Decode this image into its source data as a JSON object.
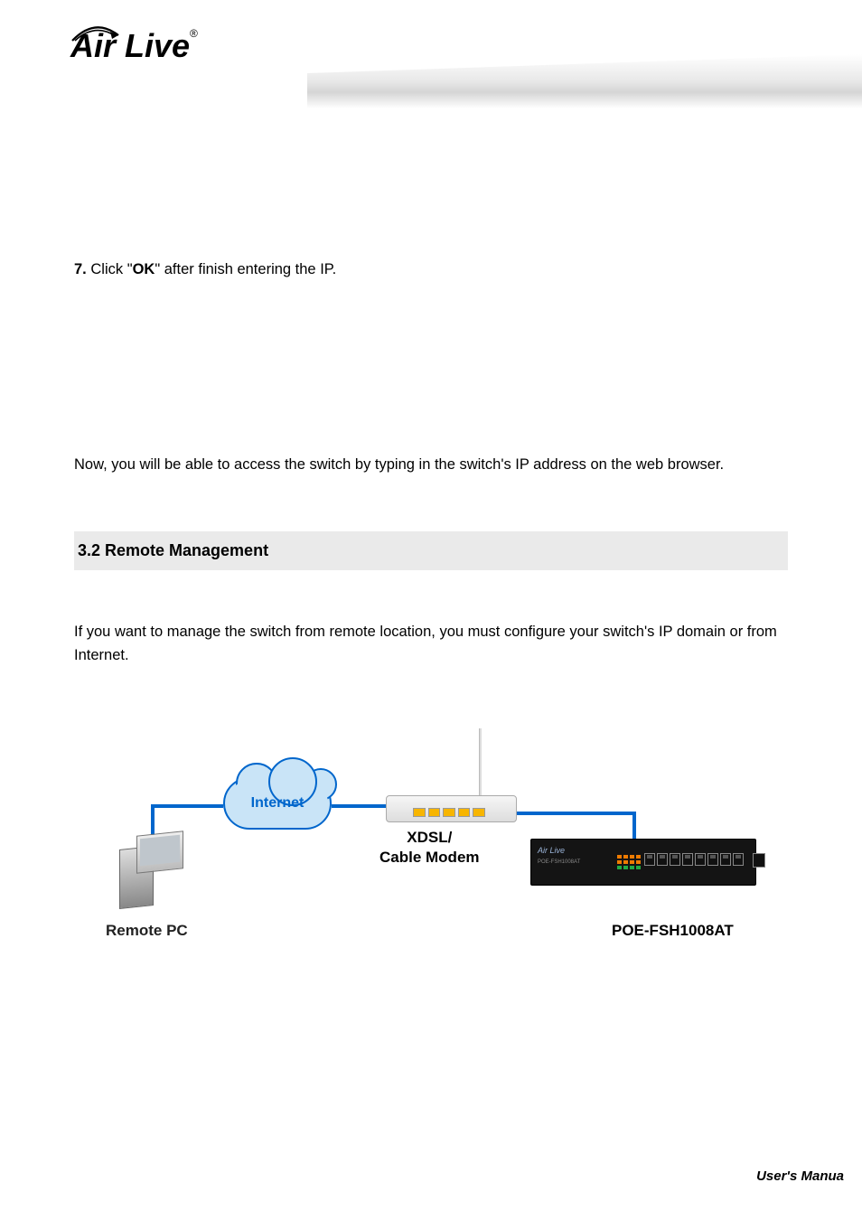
{
  "header": {
    "logo_text": "Air Live",
    "logo_reg": "®"
  },
  "body": {
    "step_num": "7.",
    "step_text_pre": "Click \"",
    "step_bold": "OK",
    "step_text_post": "\" after finish entering the IP.",
    "para_access": "Now, you will be able to access the switch by typing in the switch's IP address on the web browser.",
    "section_head": "3.2 Remote Management",
    "para_remote": "If you want to manage the switch from remote location, you must configure your switch's IP domain or from Internet."
  },
  "diagram": {
    "cloud": "Internet",
    "modem_label_line1": "XDSL/",
    "modem_label_line2": "Cable Modem",
    "remote_label": "Remote PC",
    "switch_brand": "Air Live",
    "switch_model": "POE-FSH1008AT",
    "switch_label": "POE-FSH1008AT"
  },
  "footer": {
    "text": "User's Manua"
  }
}
